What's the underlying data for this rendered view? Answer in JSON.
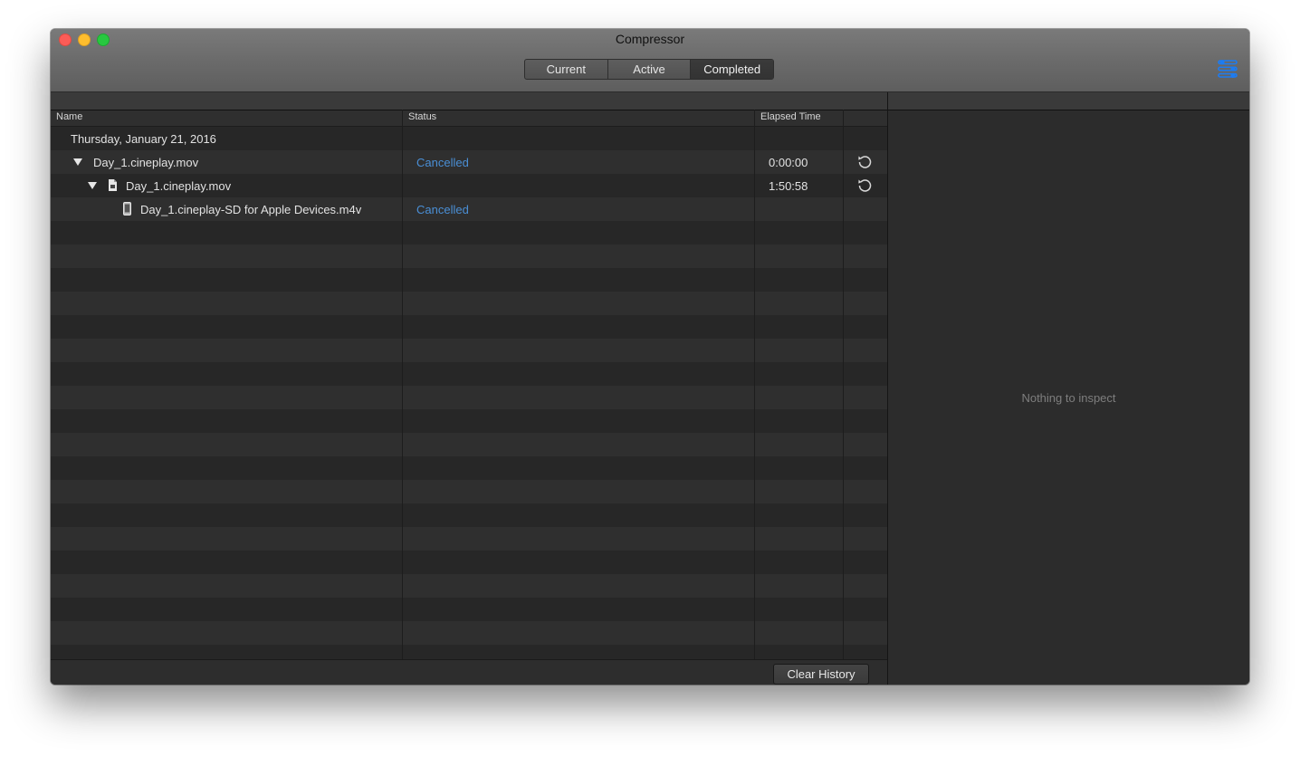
{
  "window": {
    "title": "Compressor"
  },
  "tabs": [
    "Current",
    "Active",
    "Completed"
  ],
  "selected_tab": "Completed",
  "columns": {
    "name": "Name",
    "status": "Status",
    "elapsed": "Elapsed Time"
  },
  "date_group": "Thursday, January 21, 2016",
  "rows": [
    {
      "name": "Day_1.cineplay.mov",
      "status": "Cancelled",
      "elapsed": "0:00:00"
    },
    {
      "name": "Day_1.cineplay.mov",
      "status": "",
      "elapsed": "1:50:58"
    },
    {
      "name": "Day_1.cineplay-SD for Apple Devices.m4v",
      "status": "Cancelled",
      "elapsed": ""
    }
  ],
  "footer": {
    "clear_label": "Clear History"
  },
  "inspector": {
    "empty_text": "Nothing to inspect"
  },
  "colors": {
    "status_link": "#4a8fd6",
    "accent": "#1d7cf2"
  },
  "icons": [
    "disclosure-triangle-icon",
    "document-icon",
    "device-icon",
    "resubmit-icon",
    "settings-icon"
  ]
}
